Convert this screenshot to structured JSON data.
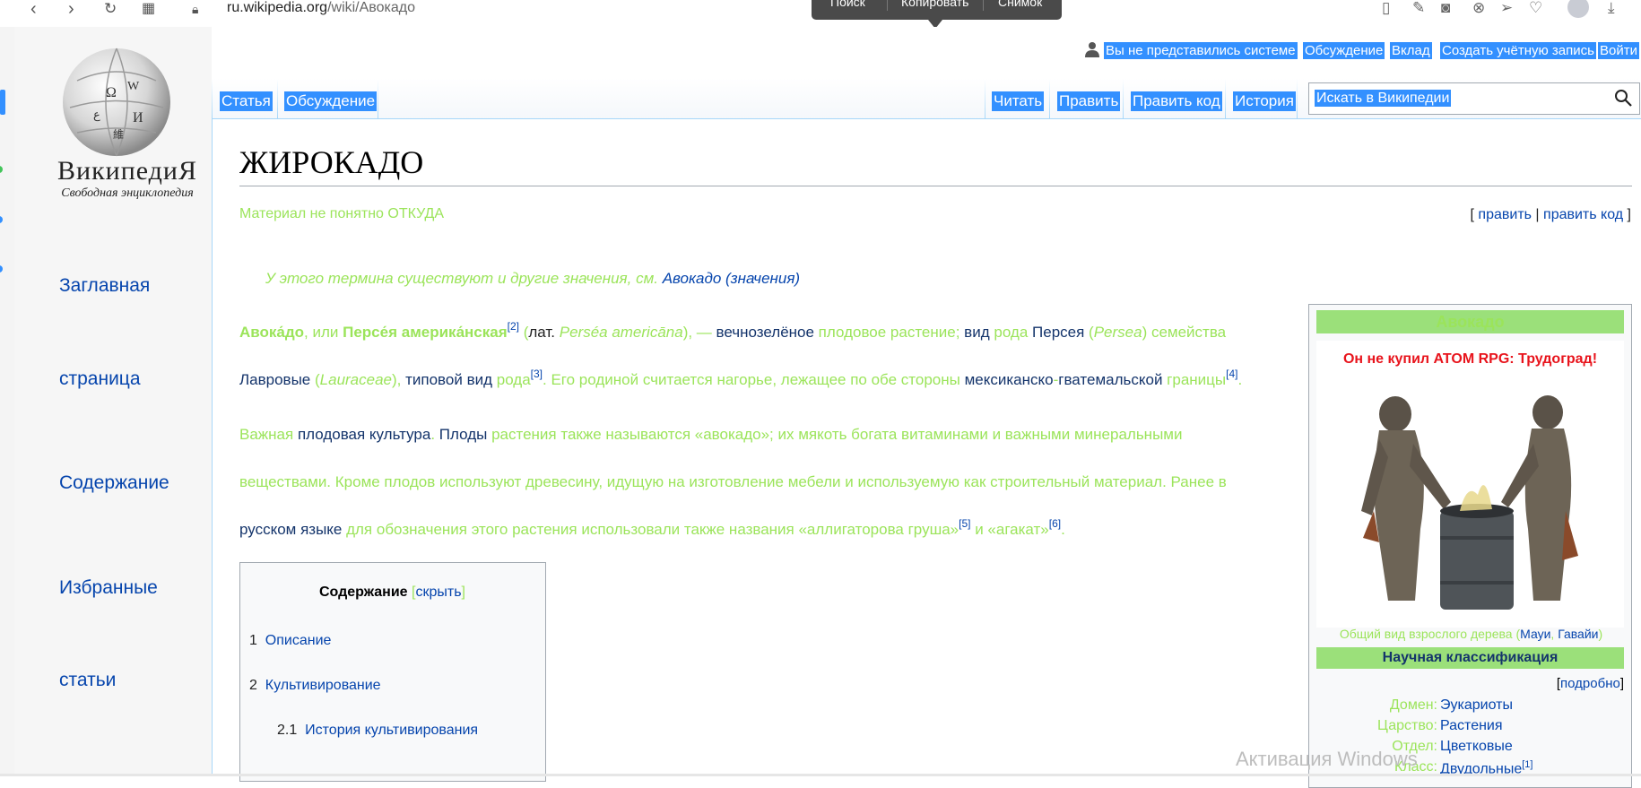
{
  "browser": {
    "url_host": "ru.wikipedia.org",
    "url_path": "/wiki/Авокадо",
    "context_menu": [
      "Поиск",
      "Копировать",
      "Снимок"
    ],
    "nav_icons": [
      "back-icon",
      "forward-icon",
      "reload-icon",
      "apps-icon",
      "lock-icon"
    ],
    "toolbar_icons": [
      "reader-icon",
      "edit-icon",
      "camera-icon",
      "shield-icon",
      "send-icon",
      "heart-icon",
      "profile-icon",
      "download-icon"
    ]
  },
  "sidebar": {
    "wordmark": "ВикипедиЯ",
    "tagline": "Свободная энциклопедия",
    "links": [
      "Заглавная",
      "страница",
      "Содержание",
      "Избранные",
      "статьи"
    ]
  },
  "personal": {
    "user_icon": "user-icon",
    "items": [
      "Вы не представились системе",
      "Обсуждение",
      "Вклад",
      "Создать учётную запись",
      "Войти"
    ]
  },
  "tabs_left": [
    "Статья",
    "Обсуждение"
  ],
  "tabs_right": [
    "Читать",
    "Править",
    "Править код",
    "История"
  ],
  "search": {
    "placeholder": "Искать в Википедии"
  },
  "article": {
    "title": "ЖИРОКАДО",
    "source_note": "Материал не понятно ОТКУДА",
    "edit_links": {
      "open": "[ ",
      "edit": "править",
      "sep": " | ",
      "edit_code": "править код",
      "close": " ]"
    },
    "hatnote_text": "У этого термина существуют и другие значения, см. ",
    "hatnote_link": "Авокадо (значения)",
    "p1": {
      "a": "Авока́до",
      "b": ", или ",
      "c": "Персе́я америка́нская",
      "ref1": "[2]",
      "d": " (",
      "e": "лат.",
      "f": " ",
      "g": "Perséa americāna",
      "h": "), — ",
      "i": "вечнозелёное",
      "j": " плодовое растение; ",
      "k": "вид",
      "l": " ",
      "m": "рода",
      "n": " ",
      "o": "Персея",
      "p": " (",
      "q": "Persea",
      "r": ") семейства",
      "s": "Лавровые",
      "t": " (",
      "u": "Lauraceae",
      "v": "), ",
      "w": "типовой вид",
      "x": " ",
      "y": "рода",
      "ref2": "[3]",
      "z": ". Его родиной считается нагорье, лежащее по обе стороны ",
      "aa": "мексиканско",
      "ab": "-",
      "ac": "гватемальской",
      "ad": " границы",
      "ref3": "[4]",
      "ae": "."
    },
    "p2": {
      "a": "Важная ",
      "b": "плодовая культура",
      "c": ". ",
      "d": "Плоды",
      "e": " растения также называются «авокадо»; их мякоть богата витаминами и важными минеральными",
      "f": "веществами. Кроме плодов используют древесину, идущую на изготовление мебели и используемую как строительный материал. Ранее в",
      "g": "русском языке",
      "h": " для обозначения этого растения использовали также названия «аллигаторова груша»",
      "ref1": "[5]",
      "i": " и «агакат»",
      "ref2": "[6]",
      "j": "."
    }
  },
  "toc": {
    "title": "Содержание",
    "hide_open": " [",
    "hide": "скрыть",
    "hide_close": "]",
    "items": [
      {
        "num": "1",
        "label": "Описание"
      },
      {
        "num": "2",
        "label": "Культивирование"
      },
      {
        "num": "2.1",
        "label": "История культивирования"
      }
    ]
  },
  "infobox": {
    "title": "Авокадо",
    "image_caption_top": "Он не купил ATOM RPG: Трудоград!",
    "caption_text": "Общий вид взрослого дерева (",
    "caption_link1": "Мауи",
    "caption_sep": ", ",
    "caption_link2": "Гавайи",
    "caption_close": ")",
    "section": "Научная классификация",
    "more_open": "[",
    "more": "подробно",
    "more_close": "]",
    "rows": [
      {
        "key": "Домен:",
        "value": "Эукариоты"
      },
      {
        "key": "Царство:",
        "value": "Растения"
      },
      {
        "key": "Отдел:",
        "value": "Цветковые"
      },
      {
        "key": "Класс:",
        "value": "Двудольные",
        "ref": "[1]"
      }
    ]
  },
  "watermark": "Активация Windows",
  "colors": {
    "link": "#0645ad",
    "green_text": "#9be45a",
    "selection": "#3390ff",
    "infobox_header": "#9be07a",
    "tab_border": "#a7d7f9"
  }
}
